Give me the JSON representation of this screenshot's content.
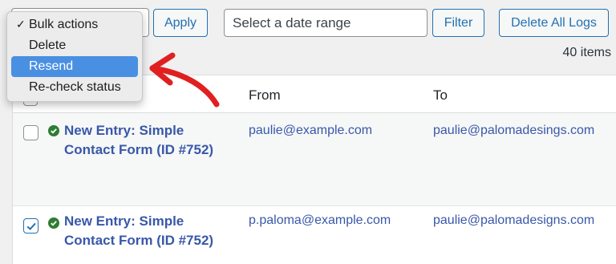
{
  "toolbar": {
    "apply_label": "Apply",
    "date_placeholder": "Select a date range",
    "filter_label": "Filter",
    "delete_all_label": "Delete All Logs",
    "items_count": "40 items"
  },
  "bulk_dropdown": {
    "options": [
      "Bulk actions",
      "Delete",
      "Resend",
      "Re-check status"
    ],
    "selected": "Bulk actions",
    "highlighted": "Resend"
  },
  "table": {
    "columns": [
      "From",
      "To"
    ],
    "rows": [
      {
        "title": "New Entry: Simple Contact Form (ID #752)",
        "from": "paulie@example.com",
        "to": "paulie@palomadesings.com",
        "checked": false,
        "status": "success"
      },
      {
        "title": "New Entry: Simple Contact Form (ID #752)",
        "from": "p.paloma@example.com",
        "to": "paulie@palomadesigns.com",
        "checked": true,
        "status": "success"
      }
    ]
  },
  "colors": {
    "link": "#3858a8",
    "button": "#2271b1",
    "highlight": "#4a90e2",
    "annotation_arrow": "#e02020",
    "status_success": "#2e7d32"
  }
}
